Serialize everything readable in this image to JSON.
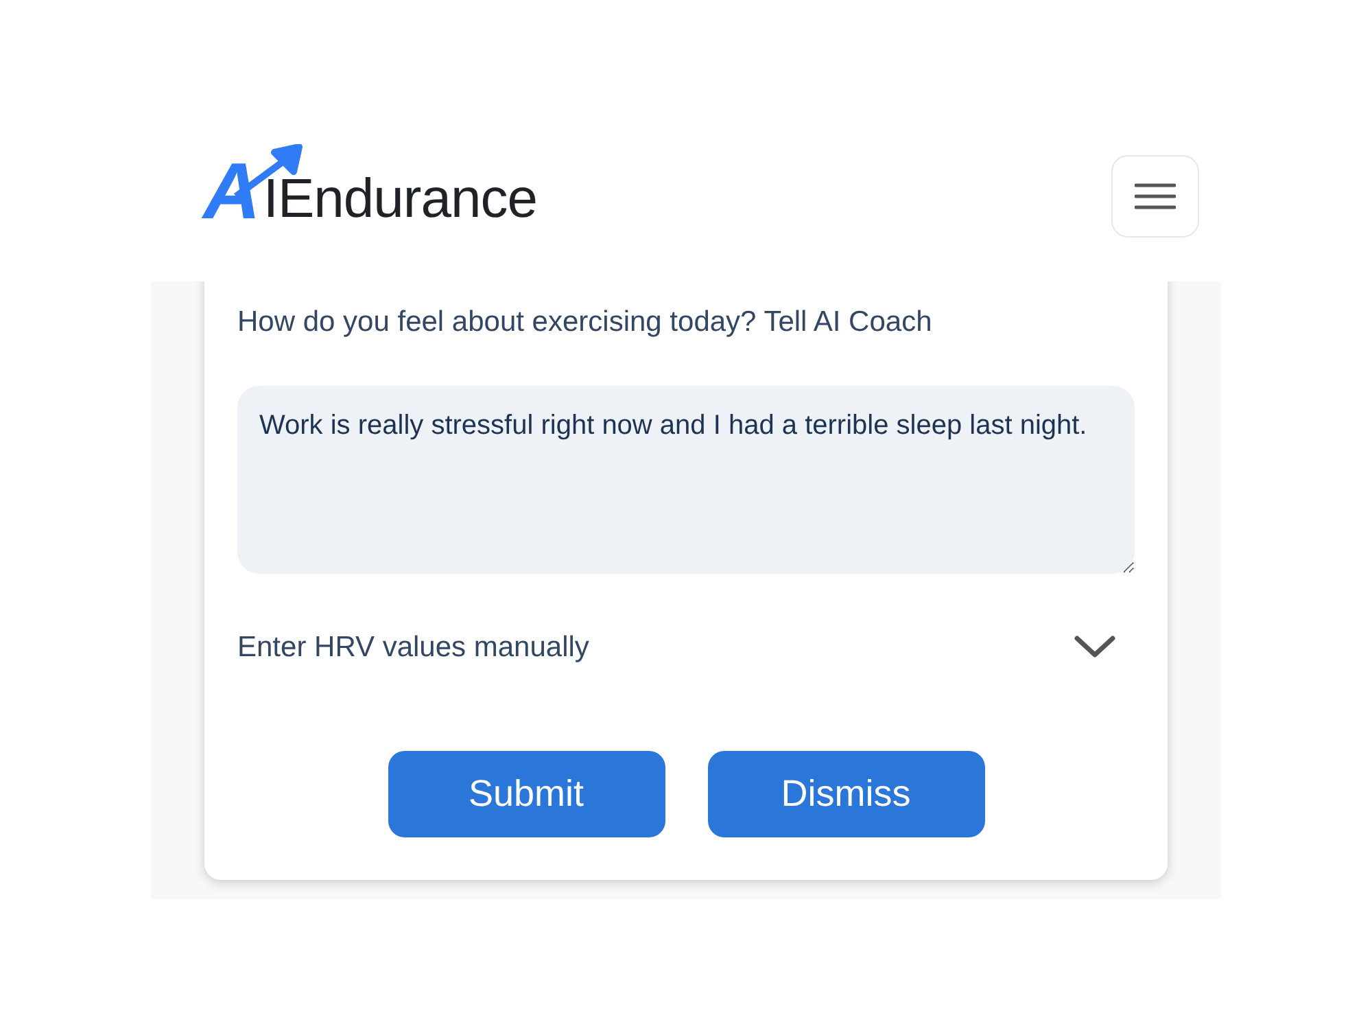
{
  "logo": {
    "accent": "A",
    "text": "IEndurance"
  },
  "prompt": "How do you feel about exercising today? Tell AI Coach",
  "feeling": {
    "value": "Work is really stressful right now and I had a terrible sleep last night."
  },
  "hrv": {
    "label": "Enter HRV values manually",
    "expanded": false
  },
  "buttons": [
    "Submit",
    "Dismiss"
  ]
}
